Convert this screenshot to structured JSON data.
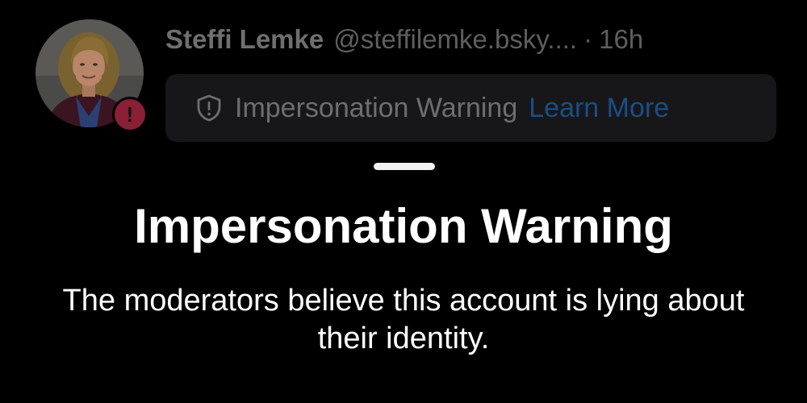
{
  "post": {
    "author": {
      "display_name": "Steffi Lemke",
      "handle": "@steffilemke.bsky....",
      "separator": "·",
      "age": "16h",
      "avatar_alert_glyph": "!"
    },
    "label_pill": {
      "icon": "shield-exclamation-icon",
      "label": "Impersonation Warning",
      "link_label": "Learn More"
    }
  },
  "sheet": {
    "title": "Impersonation Warning",
    "description": "The moderators believe this account is lying about their identity."
  },
  "colors": {
    "background": "#000000",
    "pill_background": "#171719",
    "link": "#1a4e86",
    "alert_badge": "#8a1f35",
    "text_primary": "#ffffff",
    "text_dimmed": "#6f6f6f"
  }
}
